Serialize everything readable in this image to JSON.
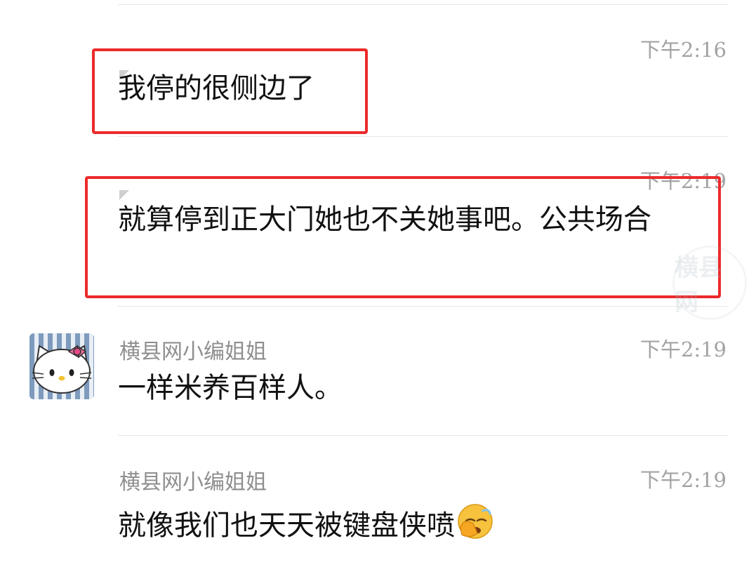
{
  "messages": [
    {
      "time": "下午2:16",
      "text": "我停的很侧边了"
    },
    {
      "time": "下午2:19",
      "text": "就算停到正大门她也不关她事吧。公共场合"
    },
    {
      "time": "下午2:19",
      "sender": "横县网小编姐姐",
      "text": "一样米养百样人。"
    },
    {
      "time": "下午2:19",
      "sender": "横县网小编姐姐",
      "text": "就像我们也天天被键盘侠喷"
    }
  ],
  "watermark": {
    "text": "横县网"
  },
  "colors": {
    "highlight": "#ec2a2a",
    "time": "#a3a3a3",
    "sender": "#8e8e8e",
    "text": "#111111"
  }
}
